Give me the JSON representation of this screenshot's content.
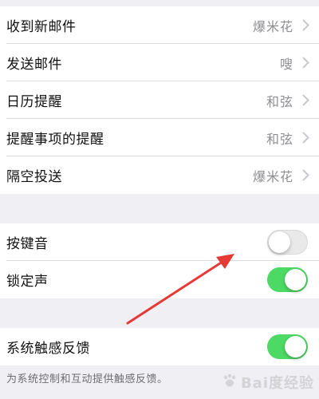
{
  "sound_list": [
    {
      "label": "收到新邮件",
      "value": "爆米花"
    },
    {
      "label": "发送邮件",
      "value": "嗖"
    },
    {
      "label": "日历提醒",
      "value": "和弦"
    },
    {
      "label": "提醒事项的提醒",
      "value": "和弦"
    },
    {
      "label": "隔空投送",
      "value": "爆米花"
    }
  ],
  "keyboard_clicks": {
    "label": "按键音",
    "state": "off"
  },
  "lock_sound": {
    "label": "锁定声",
    "state": "on"
  },
  "system_haptics": {
    "label": "系统触感反馈",
    "state": "on"
  },
  "footer": {
    "text": "为系统控制和互动提供触感反馈。"
  },
  "watermark": {
    "text": "Bai度经验"
  },
  "colors": {
    "toggle_on": "#4cd964",
    "toggle_off": "#e9e9ea",
    "arrow": "#e53935",
    "background": "#efeff4"
  },
  "icons": {
    "chevron": "chevron-right-icon",
    "annotation": "red-arrow-annotation"
  }
}
